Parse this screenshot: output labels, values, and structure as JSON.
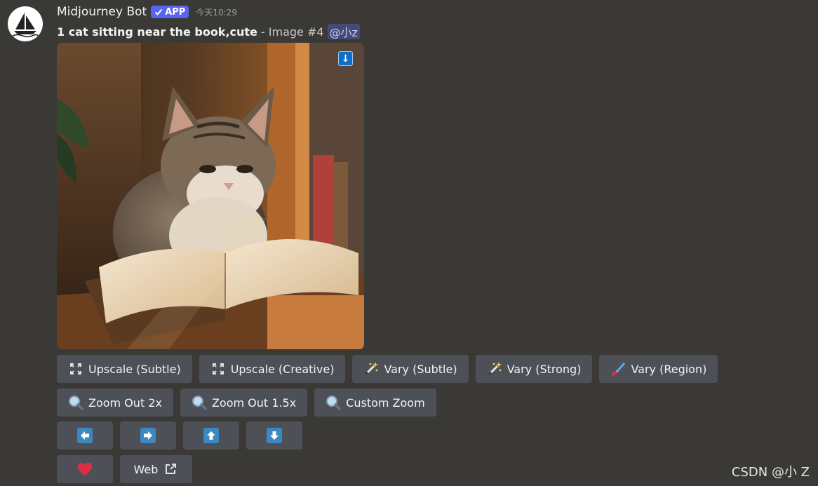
{
  "message": {
    "author": "Midjourney Bot",
    "badge": "APP",
    "timestamp": "今天10:29",
    "prompt": "1 cat sitting near the book,cute",
    "prompt_meta": "- Image #4",
    "mention": "@小z"
  },
  "image": {
    "download_label": "↓"
  },
  "buttons": {
    "row1": [
      {
        "label": "Upscale (Subtle)",
        "icon": "expand-icon"
      },
      {
        "label": "Upscale (Creative)",
        "icon": "expand-icon"
      },
      {
        "label": "Vary (Subtle)",
        "icon": "magic-wand-icon"
      },
      {
        "label": "Vary (Strong)",
        "icon": "magic-wand-icon"
      },
      {
        "label": "Vary (Region)",
        "icon": "paintbrush-icon"
      }
    ],
    "row2": [
      {
        "label": "Zoom Out 2x",
        "icon": "magnifier-icon"
      },
      {
        "label": "Zoom Out 1.5x",
        "icon": "magnifier-icon"
      },
      {
        "label": "Custom Zoom",
        "icon": "magnifier-icon"
      }
    ],
    "row3": [
      "arrow-left-icon",
      "arrow-right-icon",
      "arrow-up-icon",
      "arrow-down-icon"
    ],
    "row4": {
      "heart_icon": "heart-icon",
      "web_label": "Web",
      "web_icon": "external-link-icon"
    }
  },
  "colors": {
    "background": "#3b3935",
    "button": "#4e5058",
    "badge": "#5865f2",
    "arrow": "#3b88c3",
    "heart": "#dd2e44"
  },
  "watermark": "CSDN @小 Z"
}
